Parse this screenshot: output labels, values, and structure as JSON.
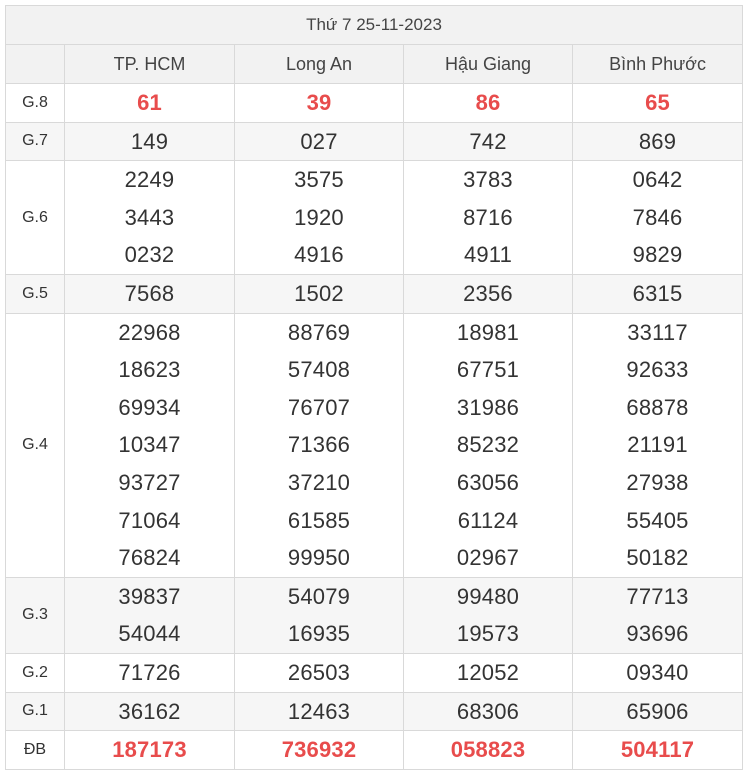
{
  "header": {
    "date": "Thứ 7 25-11-2023"
  },
  "provinces": [
    "TP. HCM",
    "Long An",
    "Hậu Giang",
    "Bình Phước"
  ],
  "prizes": [
    {
      "label": "G.8",
      "results": [
        [
          "61"
        ],
        [
          "39"
        ],
        [
          "86"
        ],
        [
          "65"
        ]
      ]
    },
    {
      "label": "G.7",
      "results": [
        [
          "149"
        ],
        [
          "027"
        ],
        [
          "742"
        ],
        [
          "869"
        ]
      ]
    },
    {
      "label": "G.6",
      "results": [
        [
          "2249",
          "3443",
          "0232"
        ],
        [
          "3575",
          "1920",
          "4916"
        ],
        [
          "3783",
          "8716",
          "4911"
        ],
        [
          "0642",
          "7846",
          "9829"
        ]
      ]
    },
    {
      "label": "G.5",
      "results": [
        [
          "7568"
        ],
        [
          "1502"
        ],
        [
          "2356"
        ],
        [
          "6315"
        ]
      ]
    },
    {
      "label": "G.4",
      "results": [
        [
          "22968",
          "18623",
          "69934",
          "10347",
          "93727",
          "71064",
          "76824"
        ],
        [
          "88769",
          "57408",
          "76707",
          "71366",
          "37210",
          "61585",
          "99950"
        ],
        [
          "18981",
          "67751",
          "31986",
          "85232",
          "63056",
          "61124",
          "02967"
        ],
        [
          "33117",
          "92633",
          "68878",
          "21191",
          "27938",
          "55405",
          "50182"
        ]
      ]
    },
    {
      "label": "G.3",
      "results": [
        [
          "39837",
          "54044"
        ],
        [
          "54079",
          "16935"
        ],
        [
          "99480",
          "19573"
        ],
        [
          "77713",
          "93696"
        ]
      ]
    },
    {
      "label": "G.2",
      "results": [
        [
          "71726"
        ],
        [
          "26503"
        ],
        [
          "12052"
        ],
        [
          "09340"
        ]
      ]
    },
    {
      "label": "G.1",
      "results": [
        [
          "36162"
        ],
        [
          "12463"
        ],
        [
          "68306"
        ],
        [
          "65906"
        ]
      ]
    },
    {
      "label": "ĐB",
      "results": [
        [
          "187173"
        ],
        [
          "736932"
        ],
        [
          "058823"
        ],
        [
          "504117"
        ]
      ]
    }
  ],
  "colors": {
    "highlight": "#e84c4c",
    "header_bg": "#f2f2f2",
    "alt_row_bg": "#f6f6f6",
    "border": "#d9d9d9"
  }
}
